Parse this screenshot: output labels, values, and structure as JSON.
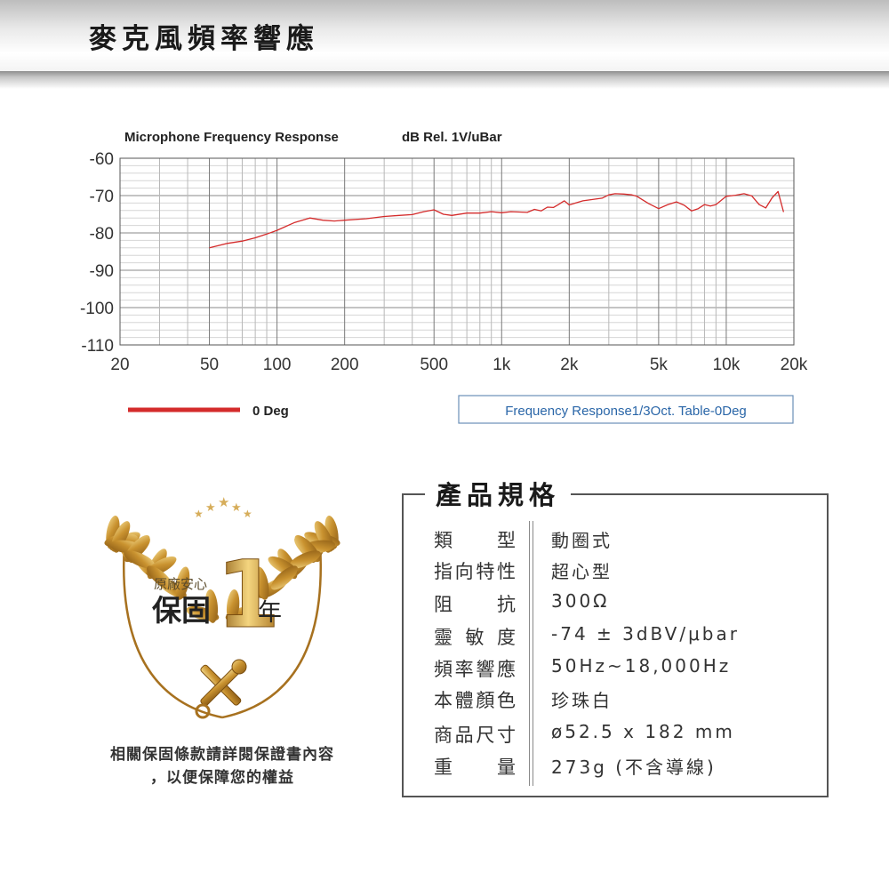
{
  "header": {
    "title": "麥克風頻率響應"
  },
  "chart_data": {
    "type": "line",
    "title": "Microphone Frequency Response",
    "ylabel": "dB Rel. 1V/uBar",
    "xlabel": "",
    "x_scale": "log",
    "xlim": [
      20,
      20000
    ],
    "ylim": [
      -110,
      -60
    ],
    "grid": true,
    "x_ticks": [
      20,
      50,
      100,
      200,
      500,
      1000,
      2000,
      5000,
      10000,
      20000
    ],
    "x_tick_labels": [
      "20",
      "50",
      "100",
      "200",
      "500",
      "1k",
      "2k",
      "5k",
      "10k",
      "20k"
    ],
    "y_ticks": [
      -60,
      -70,
      -80,
      -90,
      -100,
      -110
    ],
    "y_tick_labels": [
      "-60",
      "-70",
      "-80",
      "-90",
      "-100",
      "-110"
    ],
    "legend_position": "bottom-left",
    "series": [
      {
        "name": "0 Deg",
        "color": "#d42b2b",
        "x": [
          50,
          60,
          70,
          80,
          90,
          100,
          120,
          140,
          160,
          180,
          200,
          250,
          300,
          350,
          400,
          450,
          500,
          550,
          600,
          700,
          800,
          900,
          1000,
          1100,
          1200,
          1300,
          1400,
          1500,
          1600,
          1700,
          1800,
          1900,
          2000,
          2300,
          2500,
          2800,
          3000,
          3200,
          3500,
          3800,
          4000,
          4500,
          5000,
          5500,
          6000,
          6500,
          7000,
          7500,
          8000,
          8500,
          9000,
          10000,
          11000,
          12000,
          13000,
          14000,
          15000,
          16000,
          17000,
          18000
        ],
        "y": [
          -84,
          -82.8,
          -82.2,
          -81.3,
          -80.3,
          -79.3,
          -77.2,
          -76,
          -76.6,
          -76.8,
          -76.6,
          -76.2,
          -75.6,
          -75.3,
          -75.1,
          -74.3,
          -73.8,
          -75,
          -75.3,
          -74.7,
          -74.7,
          -74.3,
          -74.6,
          -74.3,
          -74.4,
          -74.5,
          -73.7,
          -74.1,
          -73.1,
          -73.2,
          -72.3,
          -71.4,
          -72.5,
          -71.4,
          -71.1,
          -70.7,
          -69.8,
          -69.5,
          -69.6,
          -69.8,
          -70.2,
          -72.1,
          -73.5,
          -72.4,
          -71.7,
          -72.6,
          -74.1,
          -73.5,
          -72.4,
          -72.8,
          -72.4,
          -70.2,
          -69.9,
          -69.5,
          -70.1,
          -72.4,
          -73.3,
          -70.6,
          -68.9,
          -74.4
        ]
      }
    ]
  },
  "legend": {
    "label": "0 Deg",
    "line_color": "#d42b2b"
  },
  "table_caption": "Frequency Response1/3Oct. Table-0Deg",
  "warranty": {
    "line1": "原廠安心",
    "line2": "保固",
    "number": "1",
    "unit": "年",
    "note_line1": "相關保固條款請詳閱保證書內容",
    "note_line2": "，以便保障您的權益",
    "gold_color": "#c9922f"
  },
  "specs": {
    "title": "產品規格",
    "rows": [
      {
        "label": "類型",
        "value": "動圈式"
      },
      {
        "label": "指向特性",
        "value": "超心型"
      },
      {
        "label": "阻抗",
        "value": "300Ω"
      },
      {
        "label": "靈敏度",
        "value": "-74 ± 3dBV/μbar"
      },
      {
        "label": "頻率響應",
        "value": "50Hz~18,000Hz"
      },
      {
        "label": "本體顏色",
        "value": "珍珠白"
      },
      {
        "label": "商品尺寸",
        "value": "ø52.5 x 182 mm"
      },
      {
        "label": "重量",
        "value": "273g (不含導線)"
      }
    ]
  }
}
